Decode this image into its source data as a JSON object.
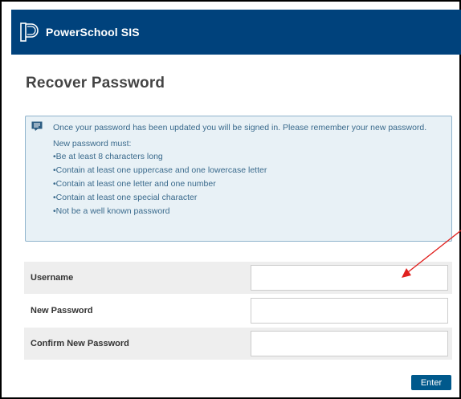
{
  "header": {
    "app_title": "PowerSchool SIS",
    "logo_icon": "powerschool-logo-icon",
    "background_color": "#00427c"
  },
  "page": {
    "title": "Recover Password"
  },
  "info": {
    "icon": "message-icon",
    "lead": "Once your password has been updated you will be signed in. Please remember your new password.",
    "rules_title": "New password must:",
    "rules": [
      "•Be at least 8 characters long",
      "•Contain at least one uppercase and one lowercase letter",
      "•Contain at least one letter and one number",
      "•Contain at least one special character",
      "•Not be a well known password"
    ]
  },
  "form": {
    "fields": [
      {
        "label": "Username",
        "value": ""
      },
      {
        "label": "New Password",
        "value": ""
      },
      {
        "label": "Confirm New Password",
        "value": ""
      }
    ],
    "submit_label": "Enter"
  },
  "annotation": {
    "arrow_color": "#e0201e"
  }
}
